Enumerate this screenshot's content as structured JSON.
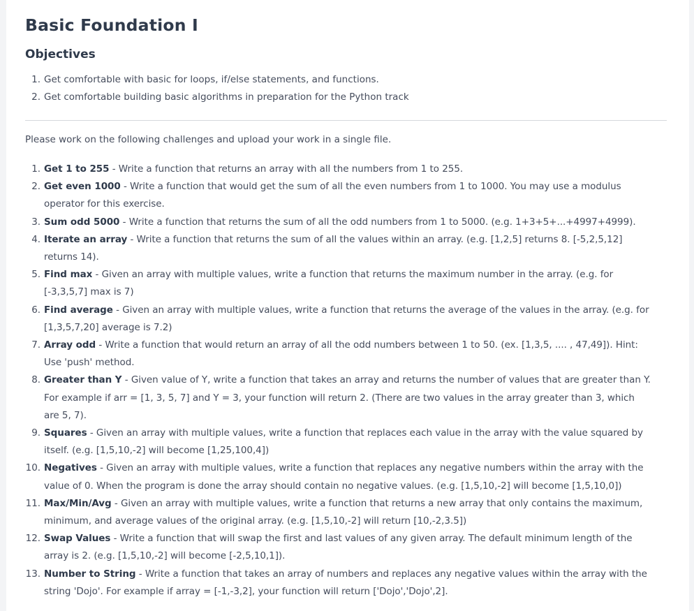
{
  "title": "Basic Foundation I",
  "objectives_heading": "Objectives",
  "objectives": [
    {
      "num": "1.",
      "text": "Get comfortable with basic for loops, if/else statements, and functions."
    },
    {
      "num": "2.",
      "text": "Get comfortable building basic algorithms in preparation for the Python track"
    }
  ],
  "intro": "Please work on the following challenges and upload your work in a single file.",
  "challenges": [
    {
      "num": "1.",
      "name": "Get 1 to 255",
      "desc": " - Write a function that returns an array with all the numbers from 1 to 255."
    },
    {
      "num": "2.",
      "name": "Get even 1000",
      "desc": " - Write a function that would get the sum of all the even numbers from 1 to 1000.  You may use a modulus operator for this exercise."
    },
    {
      "num": "3.",
      "name": "Sum odd 5000",
      "desc": " - Write a function that returns the sum of all the odd numbers from 1 to 5000. (e.g. 1+3+5+...+4997+4999)."
    },
    {
      "num": "4.",
      "name": "Iterate an array",
      "desc": " - Write a function that returns the sum of all the values within an array. (e.g. [1,2,5] returns 8. [-5,2,5,12] returns 14)."
    },
    {
      "num": "5.",
      "name": "Find max",
      "desc": " - Given an array with multiple values, write a function that returns the maximum number in the array. (e.g. for [-3,3,5,7] max is 7)"
    },
    {
      "num": "6.",
      "name": "Find average",
      "desc": " - Given an array with multiple values, write a function that returns the average of the values in the array. (e.g. for [1,3,5,7,20] average is 7.2)"
    },
    {
      "num": "7.",
      "name": "Array odd",
      "desc": " - Write a function that would return an array of all the odd numbers between 1 to 50. (ex. [1,3,5, .... , 47,49]). Hint: Use 'push' method."
    },
    {
      "num": "8.",
      "name": "Greater than Y",
      "desc": " - Given value of Y, write a function that takes an array and returns the number of values that are greater than Y. For example if arr = [1, 3, 5, 7] and Y = 3, your function will return 2. (There are two values in the array greater than 3, which are 5, 7)."
    },
    {
      "num": "9.",
      "name": "Squares",
      "desc": " - Given an array with multiple values, write a function that replaces each value in the array with the value squared by itself. (e.g. [1,5,10,-2] will become [1,25,100,4])"
    },
    {
      "num": "10.",
      "name": "Negatives",
      "desc": " - Given an array with multiple values, write a function that replaces any negative numbers within the array with the value of 0. When the program is done the array should contain no negative values. (e.g. [1,5,10,-2] will become [1,5,10,0])"
    },
    {
      "num": "11.",
      "name": "Max/Min/Avg",
      "desc": " - Given an array with multiple values, write a function that returns a new array that only contains the maximum, minimum, and average values of the original array. (e.g. [1,5,10,-2] will return [10,-2,3.5])"
    },
    {
      "num": "12.",
      "name": "Swap Values",
      "desc": " - Write a function that will swap the first and last values of any given array. The default minimum length of the array is 2. (e.g. [1,5,10,-2] will become [-2,5,10,1])."
    },
    {
      "num": "13.",
      "name": "Number to String",
      "desc": " - Write a function that takes an array of numbers and replaces any negative values within the array with the string 'Dojo'. For example if array = [-1,-3,2], your function will return ['Dojo','Dojo',2]."
    }
  ]
}
